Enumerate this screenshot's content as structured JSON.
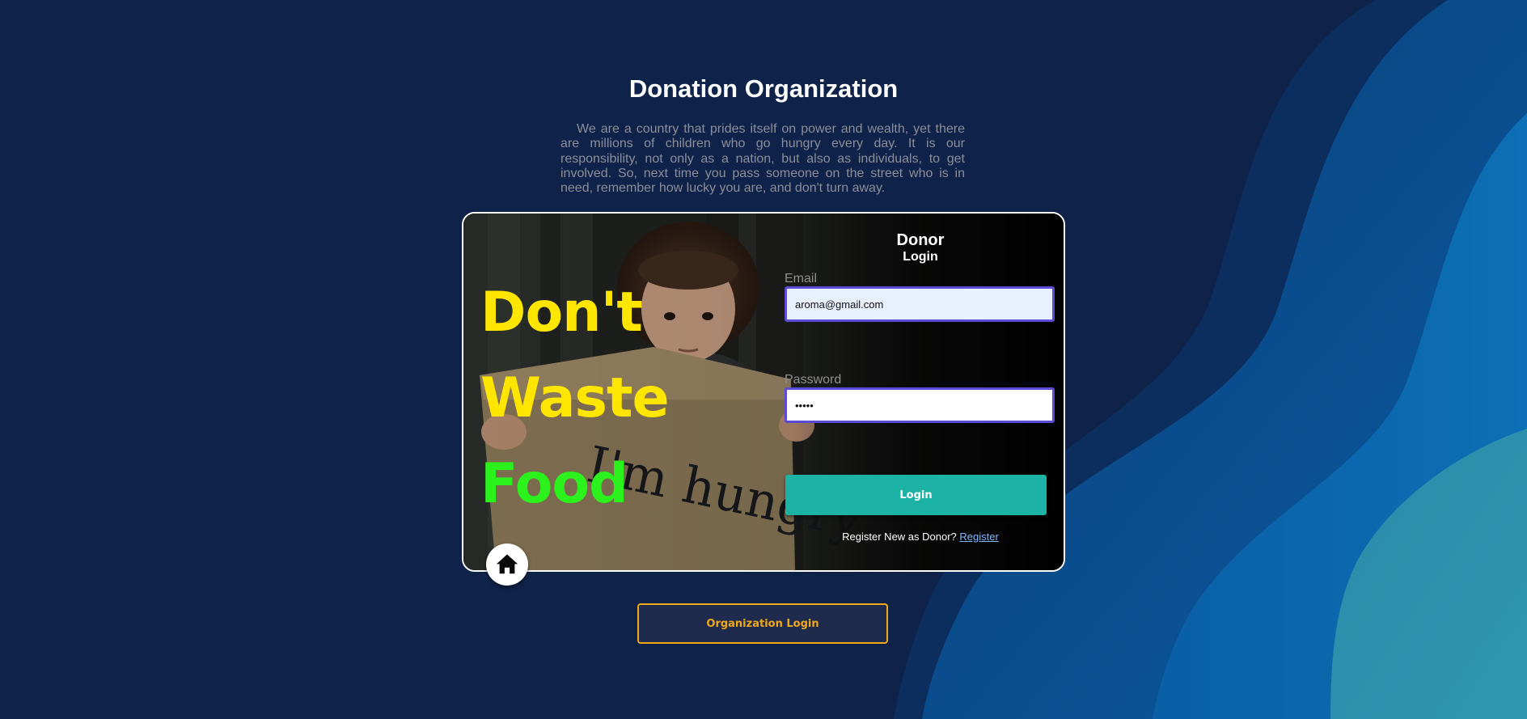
{
  "header": {
    "title": "Donation Organization",
    "intro": "We are a country that prides itself on power and wealth, yet there are millions of children who go hungry every day. It is our responsibility, not only as a nation, but also as individuals, to get involved. So, next time you pass someone on the street who is in need, remember how lucky you are, and don't turn away."
  },
  "hero": {
    "slogan": [
      "Don't",
      "Waste",
      "Food"
    ],
    "sign_text": "I'm hungry"
  },
  "login_form": {
    "title": "Donor",
    "subtitle": "Login",
    "email_label": "Email",
    "email_value": "aroma@gmail.com",
    "password_label": "Password",
    "password_value": "•••••",
    "login_button": "Login",
    "register_prompt": "Register New as Donor?",
    "register_link": "Register"
  },
  "home_button": {
    "icon": "home-icon"
  },
  "org_login_button": "Organization Login",
  "colors": {
    "background": "#0f2249",
    "slogan_yellow": "#ffe600",
    "slogan_green": "#2bf21d",
    "login_button": "#1cb2a6",
    "org_button_accent": "#f0a81a",
    "input_border": "#5b4bd6"
  }
}
